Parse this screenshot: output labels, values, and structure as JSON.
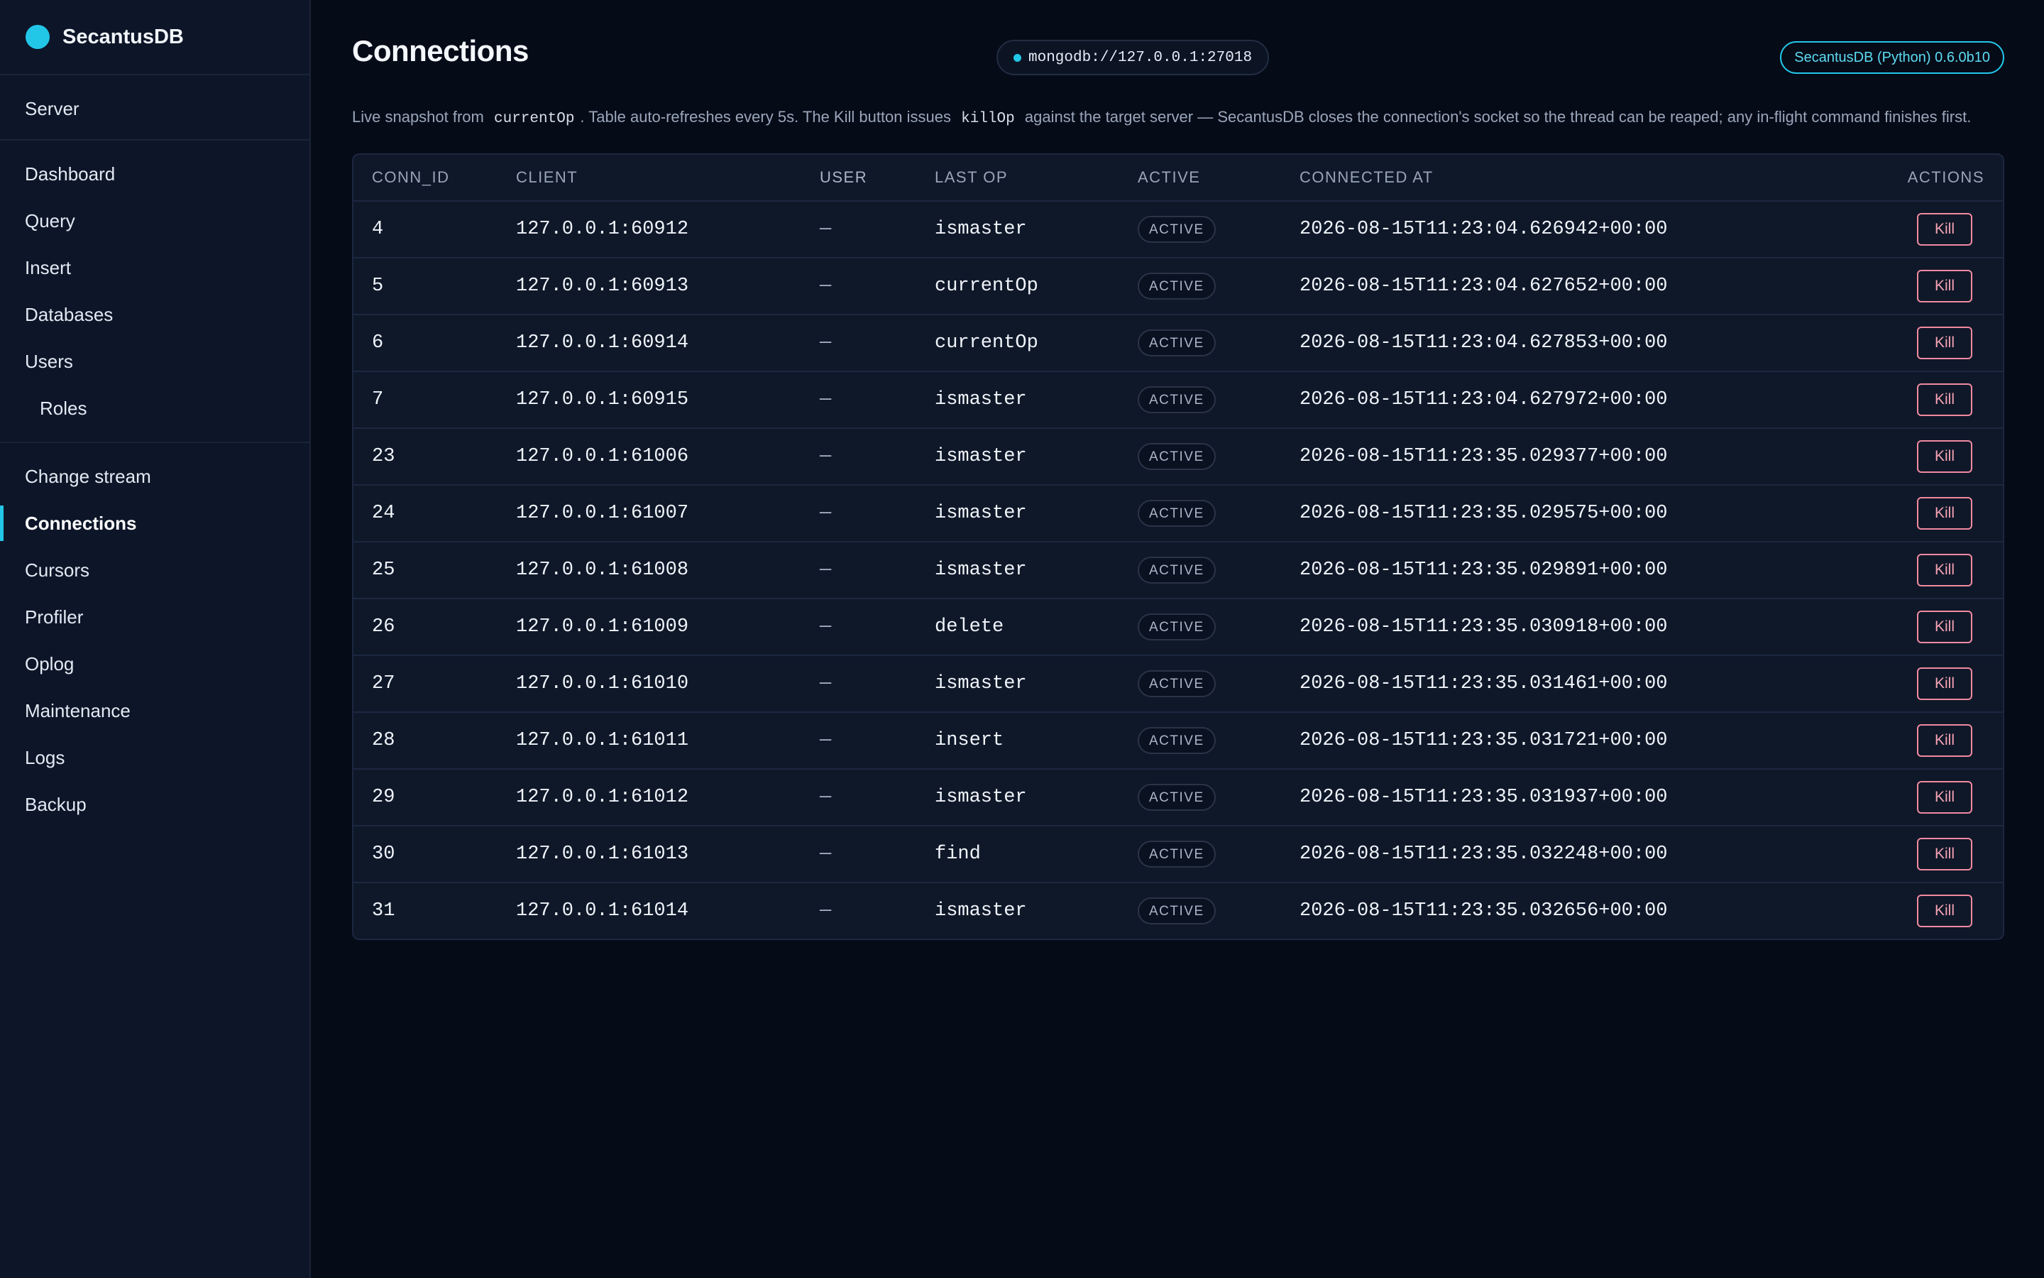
{
  "brand": {
    "name": "SecantusDB"
  },
  "sidebar": {
    "server": [
      {
        "label": "Server"
      }
    ],
    "main": [
      {
        "label": "Dashboard"
      },
      {
        "label": "Query"
      },
      {
        "label": "Insert"
      },
      {
        "label": "Databases"
      },
      {
        "label": "Users"
      },
      {
        "label": "Roles"
      }
    ],
    "tools": [
      {
        "label": "Change stream"
      },
      {
        "label": "Connections"
      },
      {
        "label": "Cursors"
      },
      {
        "label": "Profiler"
      },
      {
        "label": "Oplog"
      },
      {
        "label": "Maintenance"
      },
      {
        "label": "Logs"
      },
      {
        "label": "Backup"
      }
    ]
  },
  "header": {
    "title": "Connections",
    "connection": "mongodb://127.0.0.1:27018",
    "version": "SecantusDB (Python) 0.6.0b10"
  },
  "description": {
    "part1": "Live snapshot from",
    "code1": "currentOp",
    "part2": ". Table auto-refreshes every 5s. The Kill button issues",
    "code2": "killOp",
    "part3": "against the target server — SecantusDB closes the connection's socket so the thread can be reaped; any in-flight command finishes first."
  },
  "table": {
    "columns": {
      "conn_id": "CONN_ID",
      "client": "CLIENT",
      "user": "USER",
      "last_op": "LAST OP",
      "active": "ACTIVE",
      "connected_at": "CONNECTED AT",
      "actions": "ACTIONS"
    },
    "rows": [
      {
        "conn_id": "4",
        "client": "127.0.0.1:60912",
        "user": "—",
        "last_op": "ismaster",
        "status": "ACTIVE",
        "connected_at": "2026-08-15T11:23:04.626942+00:00",
        "action": "Kill"
      },
      {
        "conn_id": "5",
        "client": "127.0.0.1:60913",
        "user": "—",
        "last_op": "currentOp",
        "status": "ACTIVE",
        "connected_at": "2026-08-15T11:23:04.627652+00:00",
        "action": "Kill"
      },
      {
        "conn_id": "6",
        "client": "127.0.0.1:60914",
        "user": "—",
        "last_op": "currentOp",
        "status": "ACTIVE",
        "connected_at": "2026-08-15T11:23:04.627853+00:00",
        "action": "Kill"
      },
      {
        "conn_id": "7",
        "client": "127.0.0.1:60915",
        "user": "—",
        "last_op": "ismaster",
        "status": "ACTIVE",
        "connected_at": "2026-08-15T11:23:04.627972+00:00",
        "action": "Kill"
      },
      {
        "conn_id": "23",
        "client": "127.0.0.1:61006",
        "user": "—",
        "last_op": "ismaster",
        "status": "ACTIVE",
        "connected_at": "2026-08-15T11:23:35.029377+00:00",
        "action": "Kill"
      },
      {
        "conn_id": "24",
        "client": "127.0.0.1:61007",
        "user": "—",
        "last_op": "ismaster",
        "status": "ACTIVE",
        "connected_at": "2026-08-15T11:23:35.029575+00:00",
        "action": "Kill"
      },
      {
        "conn_id": "25",
        "client": "127.0.0.1:61008",
        "user": "—",
        "last_op": "ismaster",
        "status": "ACTIVE",
        "connected_at": "2026-08-15T11:23:35.029891+00:00",
        "action": "Kill"
      },
      {
        "conn_id": "26",
        "client": "127.0.0.1:61009",
        "user": "—",
        "last_op": "delete",
        "status": "ACTIVE",
        "connected_at": "2026-08-15T11:23:35.030918+00:00",
        "action": "Kill"
      },
      {
        "conn_id": "27",
        "client": "127.0.0.1:61010",
        "user": "—",
        "last_op": "ismaster",
        "status": "ACTIVE",
        "connected_at": "2026-08-15T11:23:35.031461+00:00",
        "action": "Kill"
      },
      {
        "conn_id": "28",
        "client": "127.0.0.1:61011",
        "user": "—",
        "last_op": "insert",
        "status": "ACTIVE",
        "connected_at": "2026-08-15T11:23:35.031721+00:00",
        "action": "Kill"
      },
      {
        "conn_id": "29",
        "client": "127.0.0.1:61012",
        "user": "—",
        "last_op": "ismaster",
        "status": "ACTIVE",
        "connected_at": "2026-08-15T11:23:35.031937+00:00",
        "action": "Kill"
      },
      {
        "conn_id": "30",
        "client": "127.0.0.1:61013",
        "user": "—",
        "last_op": "find",
        "status": "ACTIVE",
        "connected_at": "2026-08-15T11:23:35.032248+00:00",
        "action": "Kill"
      },
      {
        "conn_id": "31",
        "client": "127.0.0.1:61014",
        "user": "—",
        "last_op": "ismaster",
        "status": "ACTIVE",
        "connected_at": "2026-08-15T11:23:35.032656+00:00",
        "action": "Kill"
      }
    ]
  },
  "colors": {
    "accent": "#22c7e8",
    "background": "#060b18",
    "sidebar": "#0d1628",
    "kill": "#f08aa0"
  }
}
